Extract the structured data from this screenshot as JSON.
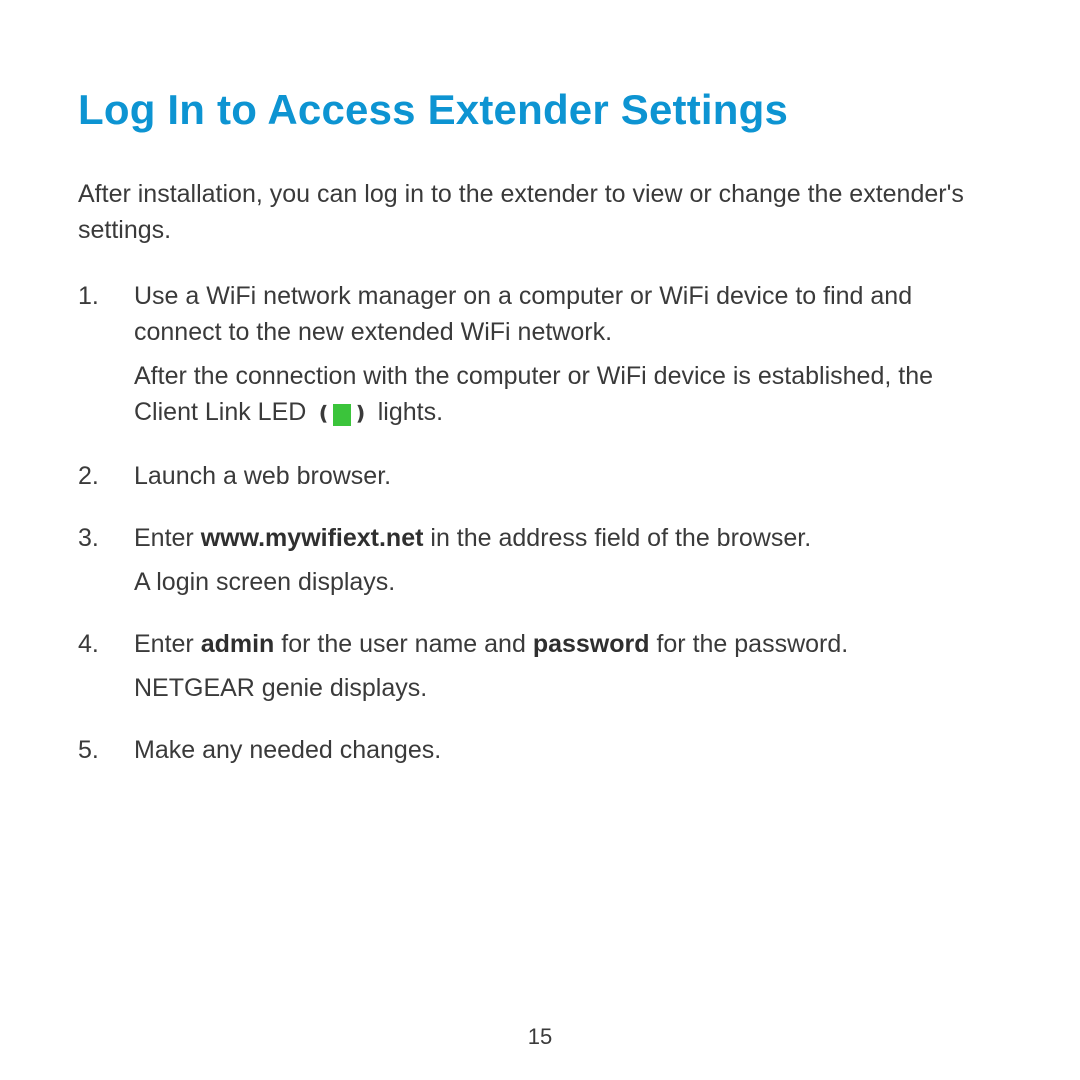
{
  "title": "Log In to Access Extender Settings",
  "intro": "After installation, you can log in to the extender to view or change the extender's settings.",
  "steps": {
    "s1a": "Use a WiFi network manager on a computer or WiFi device to find and connect to the new extended WiFi network.",
    "s1b_pre": "After the connection with the computer or WiFi device is established, the Client Link LED ",
    "s1b_post": " lights.",
    "s2": "Launch a web browser.",
    "s3_pre": "Enter ",
    "s3_bold": "www.mywifiext.net",
    "s3_post": " in the address field of the browser.",
    "s3_sub": "A login screen displays.",
    "s4_pre": "Enter ",
    "s4_bold1": "admin",
    "s4_mid": " for the user name and ",
    "s4_bold2": "password",
    "s4_post": " for the password.",
    "s4_sub": "NETGEAR genie displays.",
    "s5": "Make any needed changes."
  },
  "page_number": "15"
}
